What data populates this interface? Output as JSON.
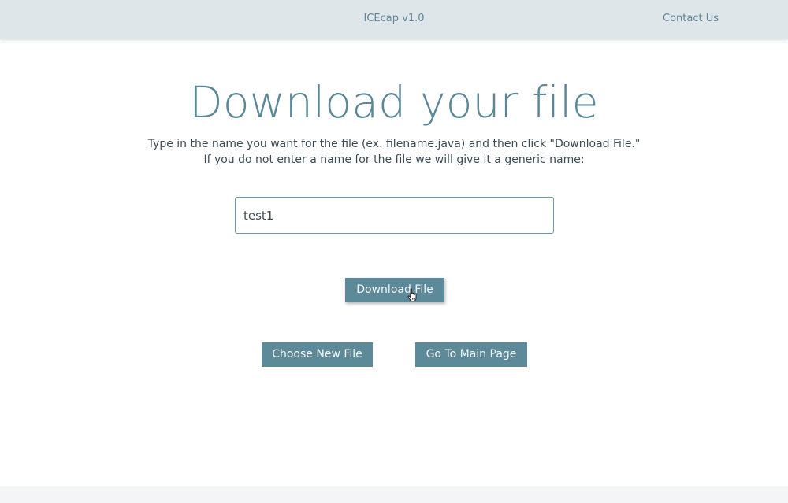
{
  "header": {
    "brand": "ICEcap v1.0",
    "contact_link": "Contact Us"
  },
  "main": {
    "title": "Download your file",
    "instructions_line1": "Type in the name you want for the file (ex. filename.java) and then click \"Download File.\"",
    "instructions_line2": "If you do not enter a name for the file we will give it a generic name:",
    "filename_value": "test1",
    "download_label": "Download File",
    "choose_new_label": "Choose New File",
    "main_page_label": "Go To Main Page"
  },
  "colors": {
    "accent": "#5d8a99",
    "header_bg": "#dfe6ea",
    "title": "#5a8898"
  },
  "icons": {
    "cursor": "hand-pointer-icon"
  }
}
